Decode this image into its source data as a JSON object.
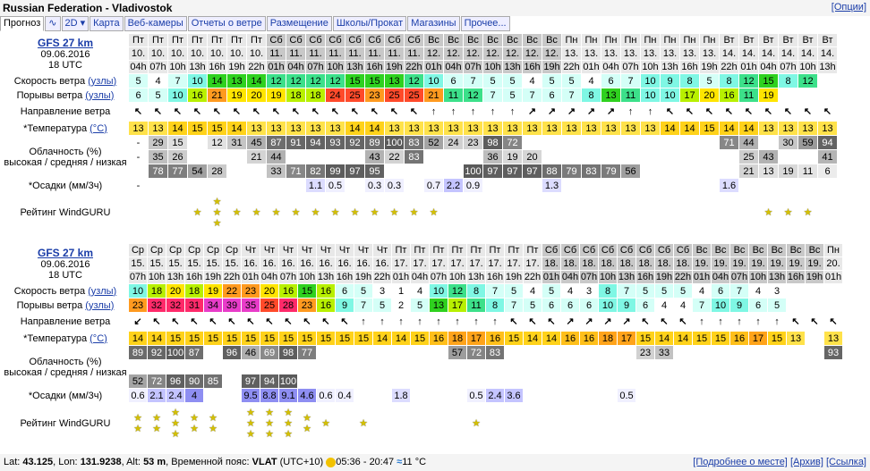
{
  "header": {
    "title": "Russian Federation - Vladivostok",
    "options_link": "[Опции]"
  },
  "tabs": [
    "Прогноз",
    "∿",
    "2D ▾",
    "Карта",
    "Веб-камеры",
    "Отчеты о ветре",
    "Размещение",
    "Школы/Прокат",
    "Магазины",
    "Прочее..."
  ],
  "labels": {
    "speed": "Скорость ветра",
    "speed_unit": "(узлы)",
    "gust": "Порывы ветра",
    "gust_unit": "(узлы)",
    "dir": "Направление ветра",
    "temp": "*Температура",
    "temp_unit": "(°C)",
    "cloud1": "Облачность (%)",
    "cloud2": "высокая / средняя / низкая",
    "precip": "*Осадки (мм/3ч)",
    "rating": "Рейтинг WindGURU"
  },
  "blocks": [
    {
      "model": "GFS 27 km",
      "date": "09.06.2016",
      "time": "18 UTC",
      "days": [
        "Пт",
        "Пт",
        "Пт",
        "Пт",
        "Пт",
        "Пт",
        "Пт",
        "Сб",
        "Сб",
        "Сб",
        "Сб",
        "Сб",
        "Сб",
        "Сб",
        "Сб",
        "Вс",
        "Вс",
        "Вс",
        "Вс",
        "Вс",
        "Вс",
        "Вс",
        "Пн",
        "Пн",
        "Пн",
        "Пн",
        "Пн",
        "Пн",
        "Пн",
        "Пн",
        "Вт",
        "Вт",
        "Вт",
        "Вт",
        "Вт",
        "Вт"
      ],
      "dates": [
        "10.",
        "10.",
        "10.",
        "10.",
        "10.",
        "10.",
        "10.",
        "11.",
        "11.",
        "11.",
        "11.",
        "11.",
        "11.",
        "11.",
        "11.",
        "12.",
        "12.",
        "12.",
        "12.",
        "12.",
        "12.",
        "12.",
        "13.",
        "13.",
        "13.",
        "13.",
        "13.",
        "13.",
        "13.",
        "13.",
        "14.",
        "14.",
        "14.",
        "14.",
        "14.",
        "14."
      ],
      "hours": [
        "04h",
        "07h",
        "10h",
        "13h",
        "16h",
        "19h",
        "22h",
        "01h",
        "04h",
        "07h",
        "10h",
        "13h",
        "16h",
        "19h",
        "22h",
        "01h",
        "04h",
        "07h",
        "10h",
        "13h",
        "16h",
        "19h",
        "22h",
        "01h",
        "04h",
        "07h",
        "10h",
        "13h",
        "16h",
        "19h",
        "22h",
        "01h",
        "04h",
        "07h",
        "10h",
        "13h"
      ],
      "speed": [
        "5",
        "4",
        "7",
        "10",
        "14",
        "13",
        "14",
        "12",
        "12",
        "12",
        "12",
        "15",
        "15",
        "13",
        "12",
        "10",
        "6",
        "7",
        "5",
        "5",
        "4",
        "5",
        "5",
        "4",
        "6",
        "7",
        "10",
        "9",
        "8",
        "5",
        "8",
        "12",
        "15",
        "8",
        "12",
        ""
      ],
      "gust": [
        "6",
        "5",
        "10",
        "16",
        "21",
        "19",
        "20",
        "19",
        "18",
        "18",
        "24",
        "25",
        "23",
        "25",
        "25",
        "21",
        "11",
        "12",
        "7",
        "5",
        "7",
        "6",
        "7",
        "8",
        "13",
        "11",
        "10",
        "10",
        "17",
        "20",
        "16",
        "11",
        "19",
        "",
        "",
        ""
      ],
      "dir": [
        "↖",
        "↖",
        "↖",
        "↖",
        "↖",
        "↖",
        "↖",
        "↖",
        "↖",
        "↖",
        "↖",
        "↖",
        "↖",
        "↖",
        "↖",
        "↑",
        "↑",
        "↑",
        "↑",
        "↑",
        "↗",
        "↗",
        "↗",
        "↗",
        "↗",
        "↑",
        "↑",
        "↖",
        "↖",
        "↖",
        "↖",
        "↖",
        "↖",
        "↖",
        "↖",
        "↖"
      ],
      "temp": [
        "13",
        "13",
        "14",
        "15",
        "15",
        "14",
        "13",
        "13",
        "13",
        "13",
        "13",
        "14",
        "14",
        "13",
        "13",
        "13",
        "13",
        "13",
        "13",
        "13",
        "13",
        "13",
        "13",
        "13",
        "13",
        "13",
        "13",
        "14",
        "14",
        "15",
        "14",
        "14",
        "13",
        "13",
        "13",
        "13"
      ],
      "cloud_h": [
        "-",
        "29",
        "15",
        "",
        "12",
        "31",
        "45",
        "87",
        "91",
        "94",
        "93",
        "92",
        "89",
        "100",
        "83",
        "52",
        "24",
        "23",
        "98",
        "72",
        "",
        "",
        "",
        "",
        "",
        "",
        "",
        "",
        "",
        "",
        "71",
        "44",
        "",
        "30",
        "59",
        "94"
      ],
      "cloud_m": [
        "-",
        "35",
        "26",
        "",
        "",
        "",
        "21",
        "44",
        "",
        "",
        "",
        "",
        "43",
        "22",
        "83",
        "",
        "",
        "",
        "36",
        "19",
        "20",
        "",
        "",
        "",
        "",
        "",
        "",
        "",
        "",
        "",
        "",
        "25",
        "43",
        "",
        "",
        "41"
      ],
      "cloud_l": [
        "",
        "78",
        "77",
        "54",
        "28",
        "",
        "",
        "33",
        "71",
        "82",
        "99",
        "97",
        "95",
        "",
        "",
        "",
        "",
        "100",
        "97",
        "97",
        "97",
        "88",
        "79",
        "83",
        "79",
        "56",
        "",
        "",
        "",
        "",
        "",
        "21",
        "13",
        "19",
        "11",
        "6"
      ],
      "precip": [
        "-",
        "",
        "",
        "",
        "",
        "",
        "",
        "",
        "",
        "1.1",
        "0.5",
        "",
        "0.3",
        "0.3",
        "",
        "0.7",
        "2.2",
        "0.9",
        "",
        "",
        "",
        "1.3",
        "",
        "",
        "",
        "",
        "",
        "",
        "",
        "",
        "1.6",
        "",
        "",
        "",
        "",
        ""
      ],
      "stars": [
        0,
        0,
        0,
        1,
        3,
        1,
        1,
        1,
        1,
        1,
        1,
        1,
        1,
        1,
        1,
        1,
        0,
        0,
        0,
        0,
        0,
        0,
        0,
        0,
        0,
        0,
        0,
        0,
        0,
        0,
        0,
        0,
        1,
        1,
        1,
        0
      ]
    },
    {
      "model": "GFS 27 km",
      "date": "09.06.2016",
      "time": "18 UTC",
      "days": [
        "Ср",
        "Ср",
        "Ср",
        "Ср",
        "Ср",
        "Ср",
        "Чт",
        "Чт",
        "Чт",
        "Чт",
        "Чт",
        "Чт",
        "Чт",
        "Чт",
        "Пт",
        "Пт",
        "Пт",
        "Пт",
        "Пт",
        "Пт",
        "Пт",
        "Пт",
        "Сб",
        "Сб",
        "Сб",
        "Сб",
        "Сб",
        "Сб",
        "Сб",
        "Сб",
        "Вс",
        "Вс",
        "Вс",
        "Вс",
        "Вс",
        "Вс",
        "Вс",
        "Пн"
      ],
      "dates": [
        "15.",
        "15.",
        "15.",
        "15.",
        "15.",
        "15.",
        "16.",
        "16.",
        "16.",
        "16.",
        "16.",
        "16.",
        "16.",
        "16.",
        "17.",
        "17.",
        "17.",
        "17.",
        "17.",
        "17.",
        "17.",
        "17.",
        "18.",
        "18.",
        "18.",
        "18.",
        "18.",
        "18.",
        "18.",
        "18.",
        "19.",
        "19.",
        "19.",
        "19.",
        "19.",
        "19.",
        "19.",
        "20."
      ],
      "hours": [
        "07h",
        "10h",
        "13h",
        "16h",
        "19h",
        "22h",
        "01h",
        "04h",
        "07h",
        "10h",
        "13h",
        "16h",
        "19h",
        "22h",
        "01h",
        "04h",
        "07h",
        "10h",
        "13h",
        "16h",
        "19h",
        "22h",
        "01h",
        "04h",
        "07h",
        "10h",
        "13h",
        "16h",
        "19h",
        "22h",
        "01h",
        "04h",
        "07h",
        "10h",
        "13h",
        "16h",
        "19h",
        "01h"
      ],
      "speed": [
        "10",
        "18",
        "20",
        "18",
        "19",
        "22",
        "23",
        "20",
        "16",
        "15",
        "16",
        "6",
        "5",
        "3",
        "1",
        "4",
        "10",
        "12",
        "8",
        "7",
        "5",
        "4",
        "5",
        "4",
        "3",
        "8",
        "7",
        "5",
        "5",
        "5",
        "4",
        "6",
        "7",
        "4",
        "3",
        "",
        "",
        ""
      ],
      "gust": [
        "23",
        "32",
        "32",
        "31",
        "34",
        "39",
        "35",
        "25",
        "28",
        "23",
        "16",
        "9",
        "7",
        "5",
        "2",
        "5",
        "13",
        "17",
        "11",
        "8",
        "7",
        "5",
        "6",
        "6",
        "6",
        "10",
        "9",
        "6",
        "4",
        "4",
        "7",
        "10",
        "9",
        "6",
        "5",
        "",
        "",
        ""
      ],
      "dir": [
        "↙",
        "↖",
        "↖",
        "↖",
        "↖",
        "↖",
        "↖",
        "↖",
        "↖",
        "↖",
        "↖",
        "↖",
        "↑",
        "↑",
        "↑",
        "↑",
        "↑",
        "↑",
        "↑",
        "↑",
        "↖",
        "↖",
        "↖",
        "↗",
        "↗",
        "↗",
        "↗",
        "↖",
        "↖",
        "↖",
        "↑",
        "↑",
        "↑",
        "↑",
        "↑",
        "↖",
        "↖",
        "↖"
      ],
      "temp": [
        "14",
        "14",
        "15",
        "15",
        "15",
        "15",
        "15",
        "15",
        "15",
        "15",
        "15",
        "15",
        "15",
        "14",
        "14",
        "15",
        "16",
        "18",
        "17",
        "16",
        "15",
        "14",
        "14",
        "16",
        "16",
        "18",
        "17",
        "15",
        "14",
        "14",
        "15",
        "15",
        "16",
        "17",
        "15",
        "13",
        "",
        "13"
      ],
      "cloud_h": [
        "89",
        "92",
        "100",
        "87",
        "",
        "96",
        "46",
        "69",
        "98",
        "77",
        "",
        "",
        "",
        "",
        "",
        "",
        "",
        "57",
        "72",
        "83",
        "",
        "",
        "",
        "",
        "",
        "",
        "",
        "23",
        "33",
        "",
        "",
        "",
        "",
        "",
        "",
        "",
        "",
        "93"
      ],
      "cloud_m": [
        "",
        "",
        "",
        "",
        "",
        "",
        "",
        "",
        "",
        "",
        "",
        "",
        "",
        "",
        "",
        "",
        "",
        "",
        "",
        "",
        "",
        "",
        "",
        "",
        "",
        "",
        "",
        "",
        "",
        "",
        "",
        "",
        "",
        "",
        "",
        "",
        "",
        ""
      ],
      "cloud_l": [
        "52",
        "72",
        "96",
        "90",
        "85",
        "",
        "97",
        "94",
        "100",
        "",
        "",
        "",
        "",
        "",
        "",
        "",
        "",
        "",
        "",
        "",
        "",
        "",
        "",
        "",
        "",
        "",
        "",
        "",
        "",
        "",
        "",
        "",
        "",
        "",
        "",
        "",
        "",
        ""
      ],
      "precip": [
        "0.6",
        "2.1",
        "2.4",
        "4",
        "",
        "",
        "9.5",
        "8.8",
        "9.1",
        "4.6",
        "0.6",
        "0.4",
        "",
        "",
        "1.8",
        "",
        "",
        "",
        "0.5",
        "2.4",
        "3.6",
        "",
        "",
        "",
        "",
        "",
        "0.5",
        "",
        "",
        "",
        "",
        "",
        "",
        "",
        "",
        "",
        "",
        ""
      ],
      "stars": [
        2,
        2,
        3,
        2,
        2,
        0,
        3,
        3,
        3,
        2,
        1,
        0,
        1,
        0,
        0,
        0,
        0,
        0,
        1,
        0,
        0,
        0,
        0,
        0,
        0,
        0,
        0,
        0,
        0,
        0,
        0,
        0,
        0,
        0,
        0,
        0,
        0,
        0
      ]
    }
  ],
  "footer": {
    "lat_label": "Lat:",
    "lat": "43.125",
    "lon_label": "Lon:",
    "lon": "131.9238",
    "alt_label": "Alt:",
    "alt": "53 m",
    "tz_label": "Временной пояс:",
    "tz": "VLAT",
    "tz_off": "(UTC+10)",
    "sun": "05:36 - 20:47",
    "water": "11 °C",
    "links": [
      "[Подробнее о месте]",
      "[Архив]",
      "[Ссылка]"
    ]
  }
}
